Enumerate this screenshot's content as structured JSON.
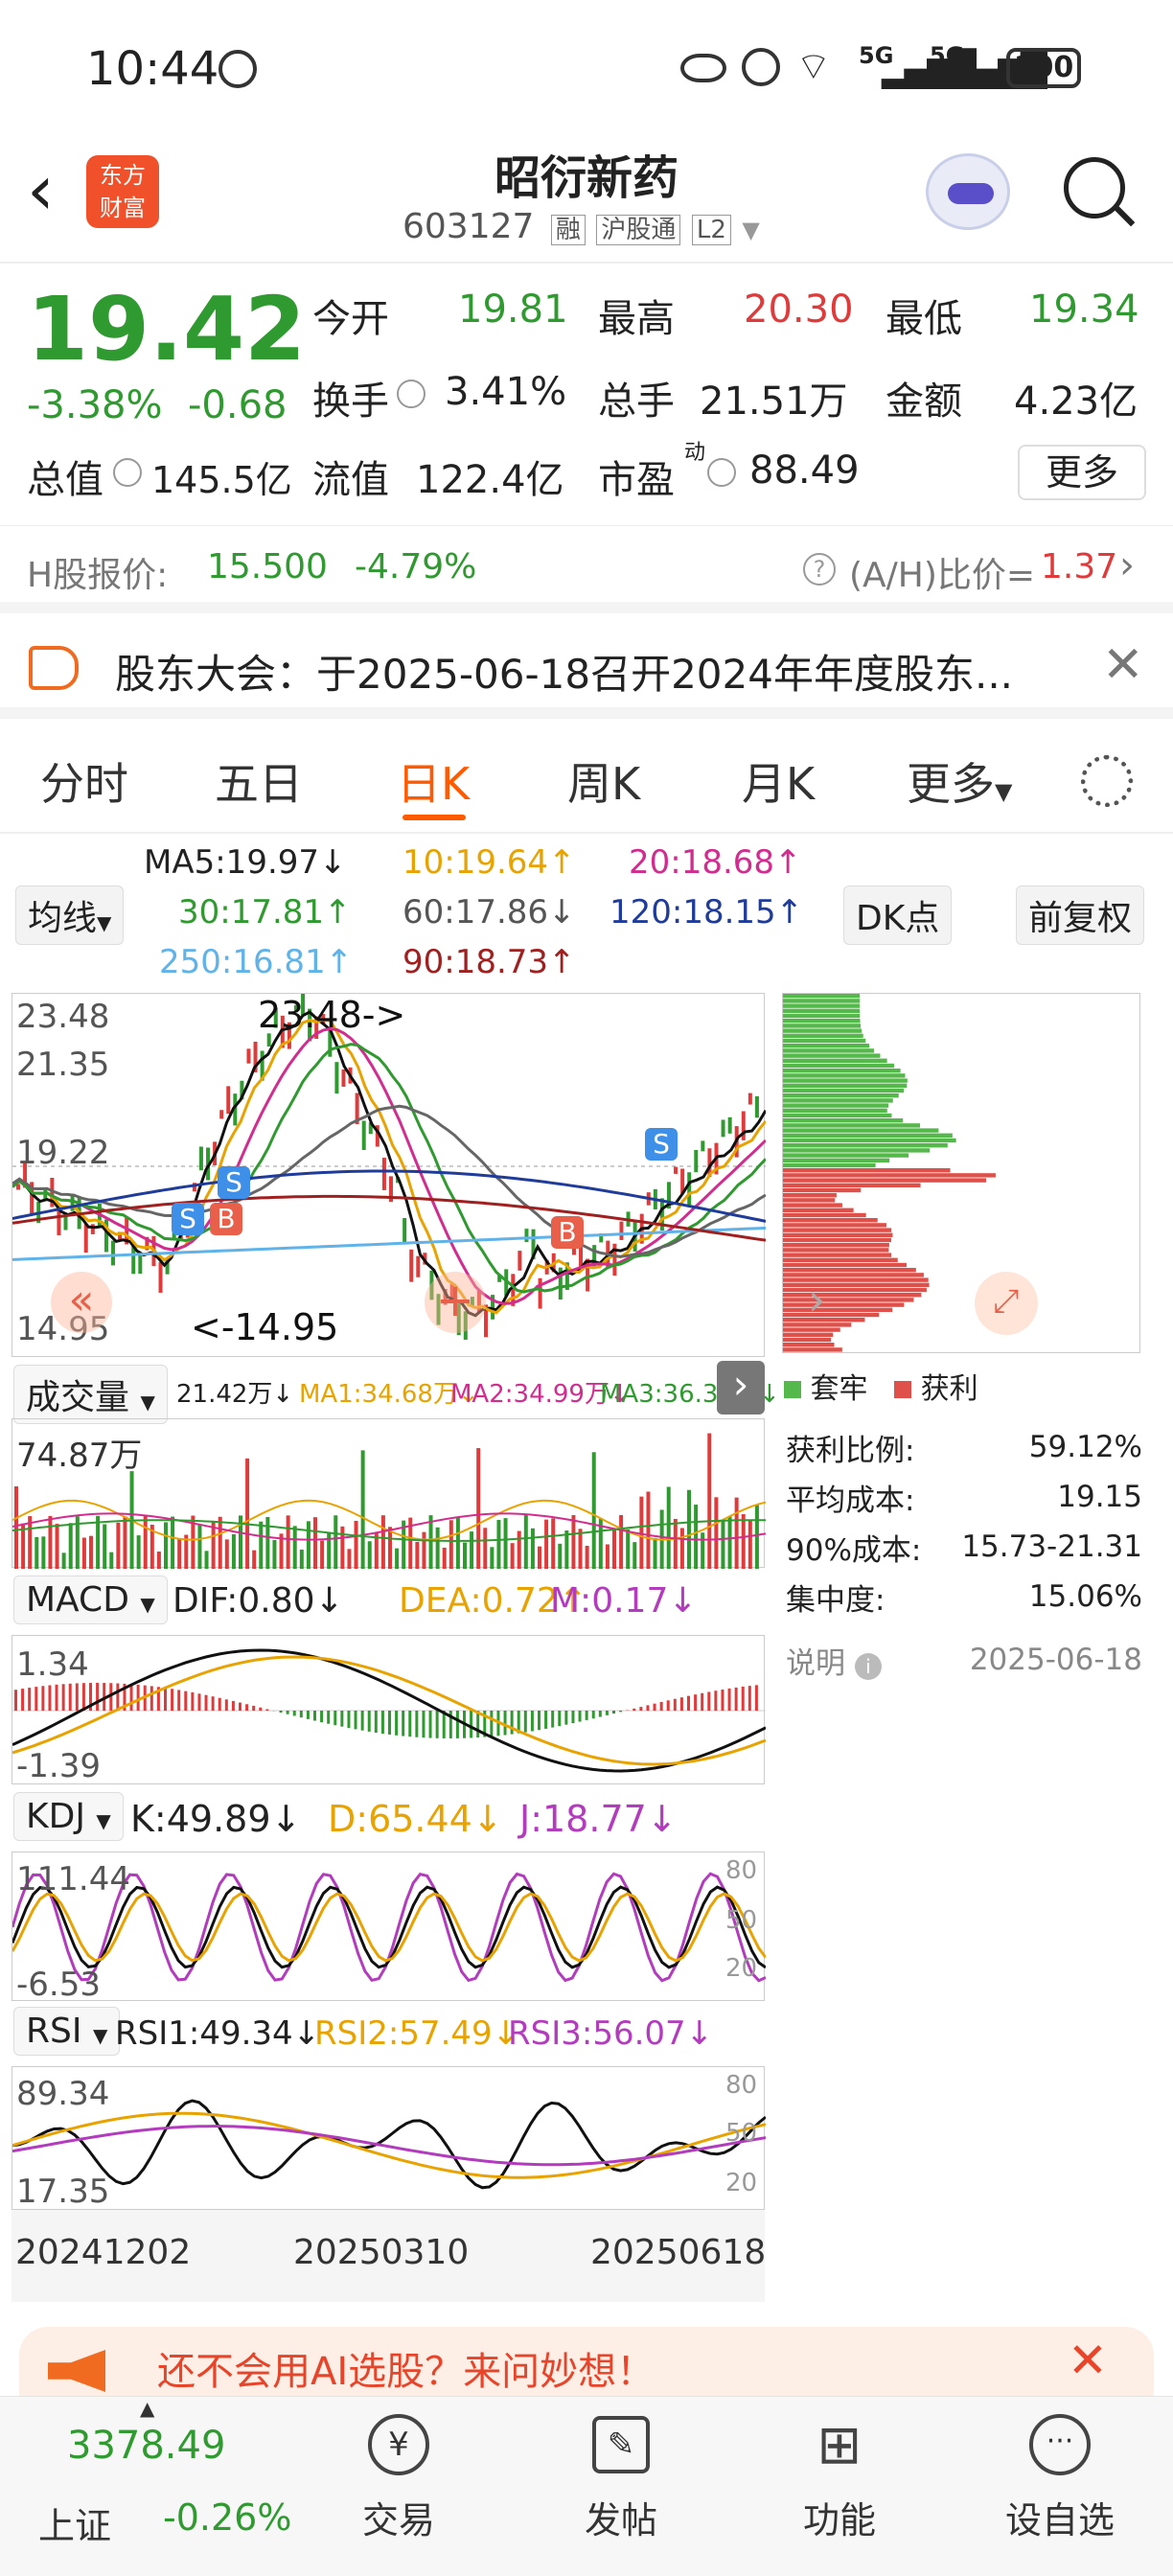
{
  "status": {
    "time": "10:44",
    "battery": "100",
    "net1": "5G",
    "net2": "5G"
  },
  "header": {
    "title": "昭衍新药",
    "code": "603127",
    "tag1": "融",
    "tag2": "沪股通",
    "tag3": "L2",
    "logo_line1": "东方",
    "logo_line2": "财富"
  },
  "quote": {
    "price": "19.42",
    "pct": "-3.38%",
    "chg": "-0.68",
    "open_label": "今开",
    "open": "19.81",
    "high_label": "最高",
    "high": "20.30",
    "low_label": "最低",
    "low": "19.34",
    "turnover_label": "换手",
    "turnover": "3.41%",
    "vol_label": "总手",
    "vol": "21.51万",
    "amt_label": "金额",
    "amt": "4.23亿",
    "mcap_label": "总值",
    "mcap": "145.5亿",
    "float_label": "流值",
    "float": "122.4亿",
    "pe_label": "市盈",
    "pe_sup": "动",
    "pe": "88.49",
    "more": "更多"
  },
  "hshare": {
    "label": "H股报价:",
    "price": "15.500",
    "pct": "-4.79%",
    "ratio_label": "(A/H)比价=",
    "ratio": "1.37"
  },
  "notice": {
    "text": "股东大会：于2025-06-18召开2024年年度股东..."
  },
  "tabs": [
    "分时",
    "五日",
    "日K",
    "周K",
    "月K",
    "更多"
  ],
  "ma": {
    "ma5": "MA5:19.97↓",
    "ma10": "10:19.64↑",
    "ma20": "20:18.68↑",
    "ma30": "30:17.81↑",
    "ma60": "60:17.86↓",
    "ma120": "120:18.15↑",
    "ma250": "250:16.81↑",
    "ma90": "90:18.73↑",
    "btn_ma": "均线",
    "btn_dk": "DK点",
    "btn_fq": "前复权"
  },
  "kchart": {
    "ymax": "23.48",
    "y2": "21.35",
    "y3": "19.22",
    "ymin": "14.95",
    "hi_note": "23.48->",
    "lo_note": "<-14.95"
  },
  "volume": {
    "label": "成交量",
    "v": "21.42万↓",
    "ma1": "MA1:34.68万↓",
    "ma2": "MA2:34.99万↓",
    "ma3": "MA3:36.30万↓",
    "max": "74.87万"
  },
  "macd": {
    "label": "MACD",
    "dif": "DIF:0.80↓",
    "dea": "DEA:0.72↑",
    "m": "M:0.17↓",
    "ymax": "1.34",
    "ymin": "-1.39"
  },
  "kdj": {
    "label": "KDJ",
    "k": "K:49.89↓",
    "d": "D:65.44↓",
    "j": "J:18.77↓",
    "ymax": "111.44",
    "ymin": "-6.53",
    "r80": "80",
    "r50": "50",
    "r20": "20"
  },
  "rsi": {
    "label": "RSI",
    "r1": "RSI1:49.34↓",
    "r2": "RSI2:57.49↓",
    "r3": "RSI3:56.07↓",
    "ymax": "89.34",
    "ymin": "17.35",
    "r80": "80",
    "r50": "50",
    "r20": "20"
  },
  "xaxis": [
    "20241202",
    "20250310",
    "20250618"
  ],
  "chips": {
    "legend1": "套牢",
    "legend2": "获利",
    "rows": [
      {
        "k": "获利比例:",
        "v": "59.12%"
      },
      {
        "k": "平均成本:",
        "v": "19.15"
      },
      {
        "k": "90%成本:",
        "v": "15.73-21.31"
      },
      {
        "k": "集中度:",
        "v": "15.06%"
      }
    ],
    "note": "说明",
    "date": "2025-06-18"
  },
  "ad": {
    "text": "还不会用AI选股？来问妙想！"
  },
  "nav": {
    "index_value": "3378.49",
    "index_name": "上证",
    "index_pct": "-0.26%",
    "items": [
      "交易",
      "发帖",
      "功能",
      "设自选"
    ]
  },
  "colors": {
    "up": "#e03a3a",
    "down": "#2f9a2f",
    "accent": "#ff6a00"
  }
}
